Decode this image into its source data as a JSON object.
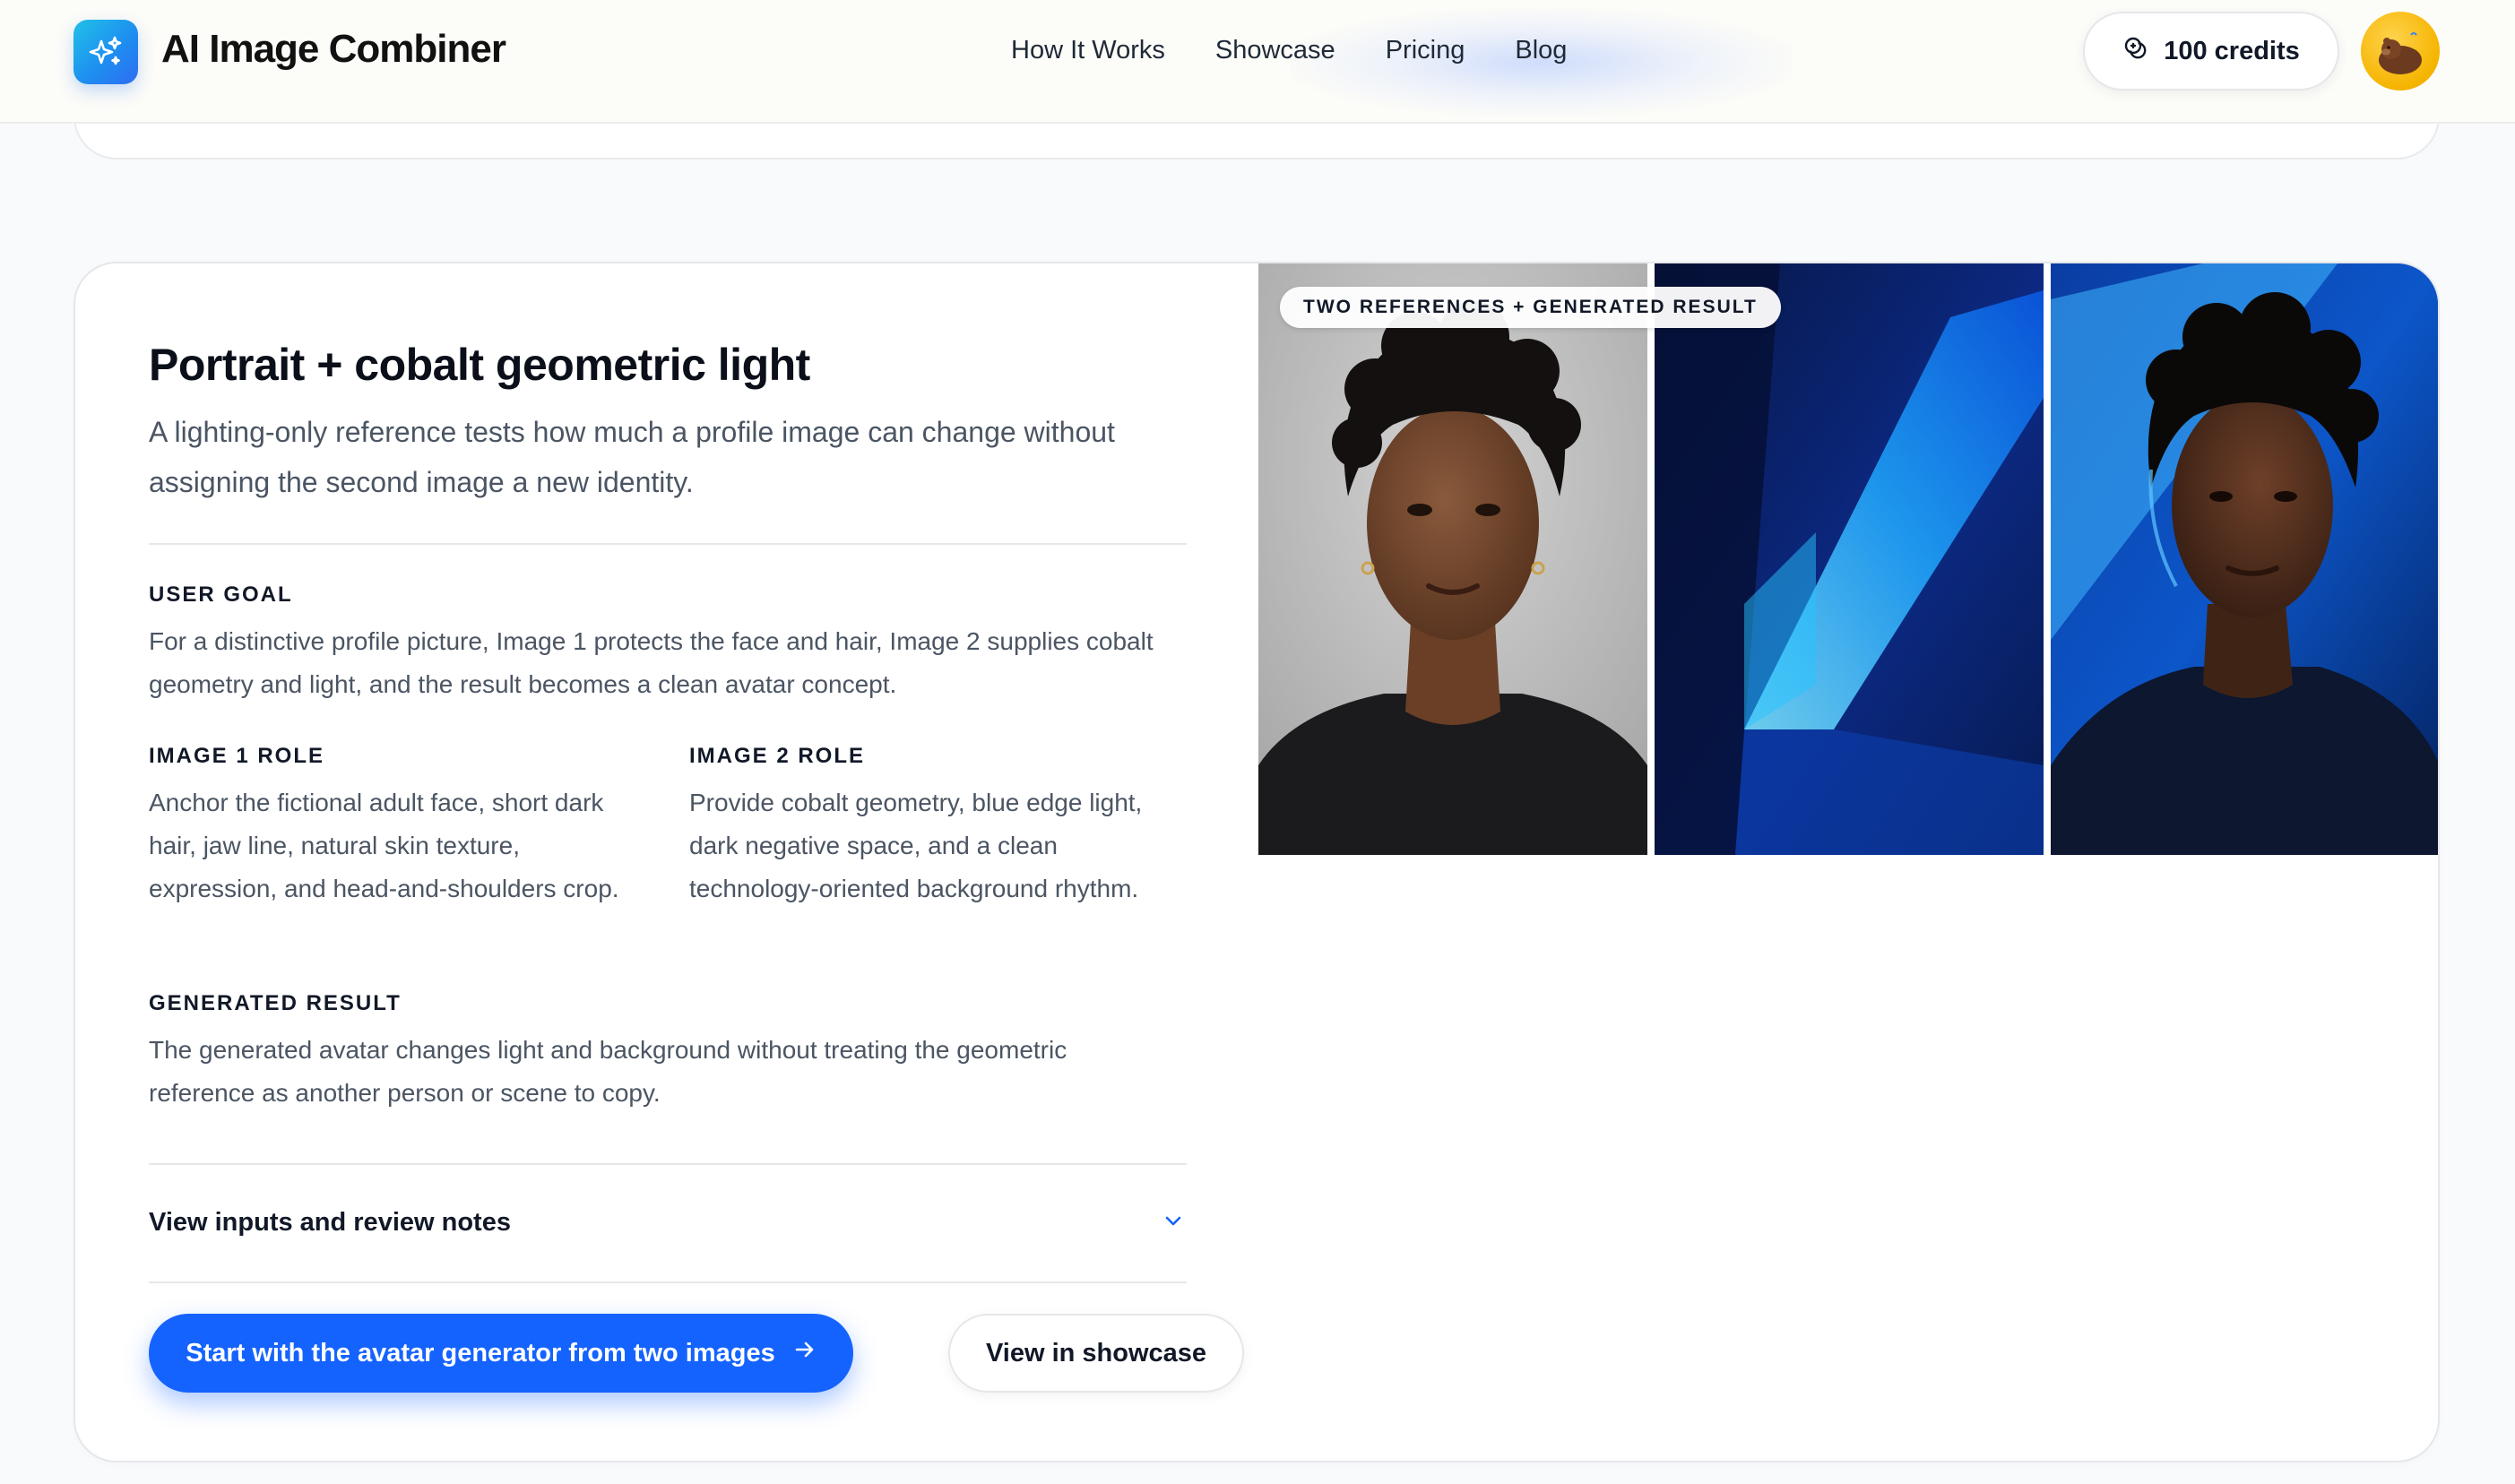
{
  "header": {
    "logo_text": "AI Image Combiner",
    "nav": [
      {
        "label": "How It Works"
      },
      {
        "label": "Showcase"
      },
      {
        "label": "Pricing"
      },
      {
        "label": "Blog"
      }
    ],
    "credits": "100 credits"
  },
  "card": {
    "title": "Portrait + cobalt geometric light",
    "subtitle": "A lighting-only reference tests how much a profile image can change without assigning the second image a new identity.",
    "user_goal": {
      "label": "USER GOAL",
      "text": "For a distinctive profile picture, Image 1 protects the face and hair, Image 2 supplies cobalt geometry and light, and the result becomes a clean avatar concept."
    },
    "image1_role": {
      "label": "IMAGE 1 ROLE",
      "text": "Anchor the fictional adult face, short dark hair, jaw line, natural skin texture, expression, and head-and-shoulders crop."
    },
    "image2_role": {
      "label": "IMAGE 2 ROLE",
      "text": "Provide cobalt geometry, blue edge light, dark negative space, and a clean technology-oriented background rhythm."
    },
    "generated_result": {
      "label": "GENERATED RESULT",
      "text": "The generated avatar changes light and background without treating the geometric reference as another person or scene to copy."
    },
    "details_toggle": "View inputs and review notes",
    "primary_button": "Start with the avatar generator from two images",
    "secondary_button": "View in showcase",
    "image_badge": "TWO REFERENCES + GENERATED RESULT"
  },
  "colors": {
    "accent": "#1463ff",
    "cobalt": "#0b4fb8",
    "credits_avatar": "#f5b400"
  }
}
